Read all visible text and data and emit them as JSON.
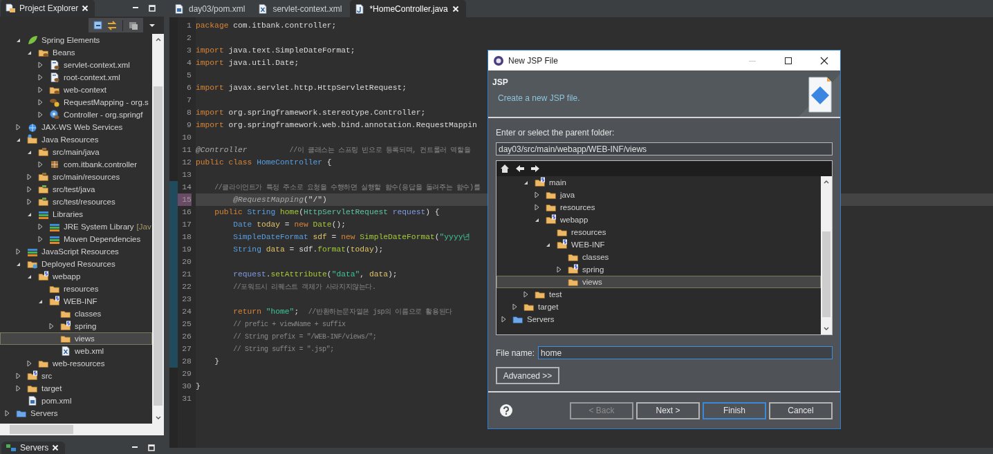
{
  "explorer": {
    "title": "Project Explorer",
    "items": [
      {
        "children": [
          {
            "label": "Spring Elements",
            "expanded": true,
            "kind": "spring",
            "selected": false,
            "children": [
              {
                "label": "Beans",
                "expanded": true,
                "kind": "bean-folder",
                "selected": false,
                "children": [
                  {
                    "label": "servlet-context.xml",
                    "expanded": false,
                    "kind": "bean-file",
                    "selected": false
                  },
                  {
                    "label": "root-context.xml",
                    "expanded": false,
                    "kind": "bean-file",
                    "selected": false
                  },
                  {
                    "label": "web-context",
                    "expanded": false,
                    "kind": "bean-folder",
                    "selected": false
                  },
                  {
                    "label": "RequestMapping - org.s",
                    "expanded": false,
                    "kind": "mapping",
                    "selected": false
                  },
                  {
                    "label": "Controller - org.springf",
                    "expanded": false,
                    "kind": "controller",
                    "selected": false
                  }
                ]
              }
            ]
          },
          {
            "label": "JAX-WS Web Services",
            "expanded": false,
            "kind": "web-services",
            "selected": false
          },
          {
            "label": "Java Resources",
            "expanded": true,
            "kind": "java-resources",
            "selected": false,
            "children": [
              {
                "label": "src/main/java",
                "expanded": true,
                "kind": "source-folder",
                "selected": false,
                "children": [
                  {
                    "label": "com.itbank.controller",
                    "expanded": false,
                    "kind": "package",
                    "selected": false
                  }
                ]
              },
              {
                "label": "src/main/resources",
                "expanded": false,
                "kind": "source-folder",
                "selected": false
              },
              {
                "label": "src/test/java",
                "expanded": false,
                "kind": "test-folder",
                "selected": false
              },
              {
                "label": "src/test/resources",
                "expanded": false,
                "kind": "test-folder",
                "selected": false
              },
              {
                "label": "Libraries",
                "expanded": true,
                "kind": "library",
                "selected": false,
                "children": [
                  {
                    "label": "JRE System Library",
                    "decoration": "[Jav",
                    "expanded": false,
                    "kind": "library",
                    "selected": false
                  },
                  {
                    "label": "Maven Dependencies",
                    "expanded": false,
                    "kind": "library",
                    "selected": false
                  }
                ]
              }
            ]
          },
          {
            "label": "JavaScript Resources",
            "expanded": false,
            "kind": "library",
            "selected": false
          },
          {
            "label": "Deployed Resources",
            "expanded": true,
            "kind": "deployed",
            "selected": false,
            "children": [
              {
                "label": "webapp",
                "expanded": true,
                "kind": "s-folder",
                "selected": false,
                "children": [
                  {
                    "label": "resources",
                    "kind": "folder",
                    "selected": false
                  },
                  {
                    "label": "WEB-INF",
                    "expanded": true,
                    "kind": "s-folder",
                    "selected": false,
                    "children": [
                      {
                        "label": "classes",
                        "kind": "folder",
                        "selected": false
                      },
                      {
                        "label": "spring",
                        "expanded": false,
                        "kind": "s-folder",
                        "selected": false
                      },
                      {
                        "label": "views",
                        "kind": "folder",
                        "selected": true
                      },
                      {
                        "label": "web.xml",
                        "kind": "xml-file",
                        "selected": false
                      }
                    ]
                  }
                ]
              },
              {
                "label": "web-resources",
                "expanded": false,
                "kind": "folder",
                "selected": false
              }
            ]
          },
          {
            "label": "src",
            "expanded": false,
            "kind": "s-folder",
            "selected": false
          },
          {
            "label": "target",
            "expanded": false,
            "kind": "folder",
            "selected": false
          },
          {
            "label": "pom.xml",
            "kind": "maven-file",
            "selected": false
          }
        ]
      },
      {
        "label": "Servers",
        "expanded": false,
        "kind": "servers-folder",
        "selected": false
      }
    ]
  },
  "servers_view": {
    "title": "Servers"
  },
  "editor": {
    "tabs": [
      {
        "label": "day03/pom.xml",
        "kind": "maven-file",
        "selected": false
      },
      {
        "label": "servlet-context.xml",
        "kind": "xml-file",
        "selected": false
      },
      {
        "label": "*HomeController.java",
        "kind": "java-file",
        "selected": true
      }
    ],
    "lines": [
      {
        "number": "1",
        "current": false,
        "changed": false,
        "tokens": [
          {
            "kind": "keyword",
            "text": "package"
          },
          {
            "kind": "plain",
            "text": " com.itbank.controller;"
          }
        ]
      },
      {
        "number": "2",
        "current": false,
        "changed": false
      },
      {
        "number": "3",
        "current": false,
        "changed": false,
        "tokens": [
          {
            "kind": "keyword",
            "text": "import"
          },
          {
            "kind": "plain",
            "text": " java.text.SimpleDateFormat;"
          }
        ]
      },
      {
        "number": "4",
        "current": false,
        "changed": false,
        "tokens": [
          {
            "kind": "keyword",
            "text": "import"
          },
          {
            "kind": "plain",
            "text": " java.util.Date;"
          }
        ]
      },
      {
        "number": "5",
        "current": false,
        "changed": false
      },
      {
        "number": "6",
        "current": false,
        "changed": false,
        "tokens": [
          {
            "kind": "keyword",
            "text": "import"
          },
          {
            "kind": "plain",
            "text": " javax.servlet.http.HttpServletRequest;"
          }
        ]
      },
      {
        "number": "7",
        "current": false,
        "changed": false
      },
      {
        "number": "8",
        "current": false,
        "changed": false,
        "tokens": [
          {
            "kind": "keyword",
            "text": "import"
          },
          {
            "kind": "plain",
            "text": " org.springframework.stereotype.Controller;"
          }
        ]
      },
      {
        "number": "9",
        "current": false,
        "changed": false,
        "tokens": [
          {
            "kind": "keyword",
            "text": "import"
          },
          {
            "kind": "plain",
            "text": " org.springframework.web.bind.annotation.RequestMappin"
          }
        ]
      },
      {
        "number": "10",
        "current": false,
        "changed": false
      },
      {
        "number": "11",
        "current": false,
        "changed": false,
        "tokens": [
          {
            "kind": "annotation",
            "text": "@Controller"
          },
          {
            "kind": "comment",
            "text": "         //이 클래스는 스프링 빈으로 등록되며, 컨트롤러 역할을"
          }
        ]
      },
      {
        "number": "12",
        "current": false,
        "changed": false,
        "tokens": [
          {
            "kind": "keyword",
            "text": "public class "
          },
          {
            "kind": "type",
            "text": "HomeController"
          },
          {
            "kind": "plain",
            "text": " {"
          }
        ]
      },
      {
        "number": "13",
        "current": false,
        "changed": false
      },
      {
        "number": "14",
        "current": false,
        "changed": true,
        "tokens": [
          {
            "kind": "comment",
            "text": "    //클라이언트가 특정 주소로 요청을 수행하면 실행할 함수(응답을 돌려주는 함수)를"
          }
        ]
      },
      {
        "number": "15",
        "current": true,
        "changed": true,
        "tokens": [
          {
            "kind": "annotation",
            "text": "        @RequestMapping"
          },
          {
            "kind": "plain",
            "text": "(\"/\")"
          }
        ]
      },
      {
        "number": "16",
        "current": false,
        "changed": true,
        "tokens": [
          {
            "kind": "keyword",
            "text": "    public "
          },
          {
            "kind": "type",
            "text": "String "
          },
          {
            "kind": "method",
            "text": "home"
          },
          {
            "kind": "plain",
            "text": "("
          },
          {
            "kind": "class",
            "text": "HttpServletRequest "
          },
          {
            "kind": "param",
            "text": "request"
          },
          {
            "kind": "plain",
            "text": ") {"
          }
        ]
      },
      {
        "number": "17",
        "current": false,
        "changed": true,
        "tokens": [
          {
            "kind": "type",
            "text": "        Date "
          },
          {
            "kind": "variable",
            "text": "today"
          },
          {
            "kind": "plain",
            "text": " = "
          },
          {
            "kind": "keyword",
            "text": "new "
          },
          {
            "kind": "method",
            "text": "Date"
          },
          {
            "kind": "plain",
            "text": "();"
          }
        ]
      },
      {
        "number": "18",
        "current": false,
        "changed": true,
        "tokens": [
          {
            "kind": "type",
            "text": "        SimpleDateFormat "
          },
          {
            "kind": "variable",
            "text": "sdf"
          },
          {
            "kind": "plain",
            "text": " = "
          },
          {
            "kind": "keyword",
            "text": "new "
          },
          {
            "kind": "method",
            "text": "SimpleDateFormat"
          },
          {
            "kind": "plain",
            "text": "("
          },
          {
            "kind": "string",
            "text": "\"yyyy년"
          }
        ]
      },
      {
        "number": "19",
        "current": false,
        "changed": true,
        "tokens": [
          {
            "kind": "type",
            "text": "        String "
          },
          {
            "kind": "variable",
            "text": "data"
          },
          {
            "kind": "plain",
            "text": " = sdf."
          },
          {
            "kind": "method",
            "text": "format"
          },
          {
            "kind": "plain",
            "text": "("
          },
          {
            "kind": "variable",
            "text": "today"
          },
          {
            "kind": "plain",
            "text": ");"
          }
        ]
      },
      {
        "number": "20",
        "current": false,
        "changed": true
      },
      {
        "number": "21",
        "current": false,
        "changed": true,
        "tokens": [
          {
            "kind": "param",
            "text": "        request"
          },
          {
            "kind": "plain",
            "text": "."
          },
          {
            "kind": "method",
            "text": "setAttribute"
          },
          {
            "kind": "plain",
            "text": "("
          },
          {
            "kind": "string",
            "text": "\"data\""
          },
          {
            "kind": "plain",
            "text": ", "
          },
          {
            "kind": "variable",
            "text": "data"
          },
          {
            "kind": "plain",
            "text": ");"
          }
        ]
      },
      {
        "number": "22",
        "current": false,
        "changed": true,
        "tokens": [
          {
            "kind": "comment",
            "text": "        //포워드시 리퀘스트 객체가 사라지지않는다."
          }
        ]
      },
      {
        "number": "23",
        "current": false,
        "changed": true
      },
      {
        "number": "24",
        "current": false,
        "changed": true,
        "tokens": [
          {
            "kind": "keyword",
            "text": "        return "
          },
          {
            "kind": "string",
            "text": "\"home\""
          },
          {
            "kind": "plain",
            "text": ";  "
          },
          {
            "kind": "comment",
            "text": "//반환하는문자열은 jsp의 이름으로 활용된다"
          }
        ]
      },
      {
        "number": "25",
        "current": false,
        "changed": true,
        "tokens": [
          {
            "kind": "comment",
            "text": "        // prefic + viewName + suffix"
          }
        ]
      },
      {
        "number": "26",
        "current": false,
        "changed": true,
        "tokens": [
          {
            "kind": "comment",
            "text": "        // String prefix = \"/WEB-INF/views/\";"
          }
        ]
      },
      {
        "number": "27",
        "current": false,
        "changed": true,
        "tokens": [
          {
            "kind": "comment",
            "text": "        // String suffix = \".jsp\";"
          }
        ]
      },
      {
        "number": "28",
        "current": false,
        "changed": true,
        "tokens": [
          {
            "kind": "plain",
            "text": "    }"
          }
        ]
      },
      {
        "number": "29",
        "current": false,
        "changed": false
      },
      {
        "number": "30",
        "current": false,
        "changed": false,
        "tokens": [
          {
            "kind": "plain",
            "text": "}"
          }
        ]
      },
      {
        "number": "31",
        "current": false,
        "changed": false
      }
    ]
  },
  "dialog": {
    "title": "New JSP File",
    "heading": "JSP",
    "description": "Create a new JSP file.",
    "folder_label": "Enter or select the parent folder:",
    "folder_value": "day03/src/main/webapp/WEB-INF/views",
    "tree": {
      "items": [
        {
          "children": [
            {
              "children": [
                {
                  "label": "main",
                  "expanded": true,
                  "kind": "s-folder",
                  "selected": false,
                  "children": [
                    {
                      "label": "java",
                      "expanded": false,
                      "kind": "folder",
                      "selected": false
                    },
                    {
                      "label": "resources",
                      "expanded": false,
                      "kind": "folder",
                      "selected": false
                    },
                    {
                      "label": "webapp",
                      "expanded": true,
                      "kind": "s-folder",
                      "selected": false,
                      "children": [
                        {
                          "label": "resources",
                          "kind": "folder",
                          "selected": false
                        },
                        {
                          "label": "WEB-INF",
                          "expanded": true,
                          "kind": "s-folder",
                          "selected": false,
                          "children": [
                            {
                              "label": "classes",
                              "kind": "folder",
                              "selected": false
                            },
                            {
                              "label": "spring",
                              "expanded": false,
                              "kind": "s-folder",
                              "selected": false
                            },
                            {
                              "label": "views",
                              "kind": "folder",
                              "selected": true
                            }
                          ]
                        }
                      ]
                    }
                  ]
                },
                {
                  "label": "test",
                  "expanded": false,
                  "kind": "folder",
                  "selected": false
                }
              ]
            },
            {
              "label": "target",
              "expanded": false,
              "kind": "folder",
              "selected": false
            }
          ]
        },
        {
          "label": "Servers",
          "expanded": false,
          "kind": "servers-folder",
          "selected": false
        }
      ]
    },
    "file_name_label": "File name:",
    "file_name_value": "home",
    "advanced_label": "Advanced >>",
    "buttons": [
      {
        "label": "< Back",
        "disabled": true,
        "default": false
      },
      {
        "label": "Next >",
        "disabled": false,
        "default": false
      },
      {
        "label": "Finish",
        "disabled": false,
        "default": true
      },
      {
        "label": "Cancel",
        "disabled": false,
        "default": false
      }
    ]
  }
}
